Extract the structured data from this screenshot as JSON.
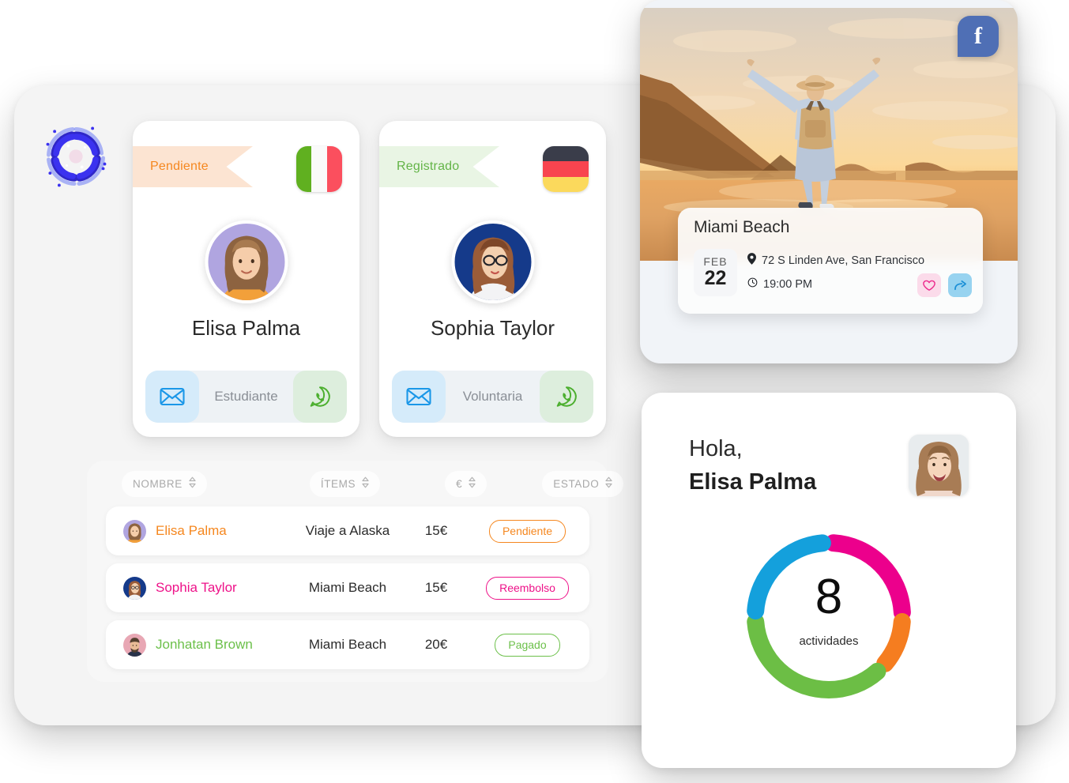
{
  "app": {
    "logo_name": "galaxy-spiral-logo",
    "panel_bg": "#f4f4f4"
  },
  "profile_cards": [
    {
      "status": "Pendiente",
      "status_color": "#f5871f",
      "status_bg": "#fce4d2",
      "flag": "it",
      "flag_label": "Italia",
      "name": "Elisa Palma",
      "role": "Estudiante",
      "mail_icon": "envelope-icon",
      "whatsapp_icon": "whatsapp-icon",
      "avatar_bg": "#b0a5e0"
    },
    {
      "status": "Registrado",
      "status_color": "#63b447",
      "status_bg": "#e9f5e4",
      "flag": "de",
      "flag_label": "Alemania",
      "name": "Sophia Taylor",
      "role": "Voluntaria",
      "mail_icon": "envelope-icon",
      "whatsapp_icon": "whatsapp-icon",
      "avatar_bg": "#153a8a"
    }
  ],
  "table": {
    "columns": [
      {
        "label": "NOMBRE",
        "sort": "sort-icon"
      },
      {
        "label": "ÍTEMS",
        "sort": "sort-icon"
      },
      {
        "label": "€",
        "sort": "sort-icon"
      },
      {
        "label": "ESTADO",
        "sort": "sort-icon"
      }
    ],
    "rows": [
      {
        "name": "Elisa Palma",
        "name_color": "#f5871f",
        "avatar_bg": "#b0a5e0",
        "item": "Viaje a Alaska",
        "amount": "15€",
        "status": "Pendiente",
        "status_color": "#f5871f"
      },
      {
        "name": "Sophia Taylor",
        "name_color": "#ee1289",
        "avatar_bg": "#153a8a",
        "item": "Miami Beach",
        "amount": "15€",
        "status": "Reembolso",
        "status_color": "#ee1289"
      },
      {
        "name": "Jonhatan Brown",
        "name_color": "#6cc04a",
        "avatar_bg": "#e8a7b4",
        "item": "Miami Beach",
        "amount": "20€",
        "status": "Pagado",
        "status_color": "#6cc04a"
      }
    ]
  },
  "event_card": {
    "photo_alt": "beach-sunset-traveler-photo",
    "facebook_glyph": "f",
    "facebook_bg": "#4f6fb5",
    "title": "Miami Beach",
    "month": "FEB",
    "day": "22",
    "location_icon": "map-pin-icon",
    "location": "72 S Linden Ave, San Francisco",
    "time_icon": "clock-icon",
    "time": "19:00 PM",
    "like_icon": "heart-icon",
    "share_icon": "share-arrow-icon"
  },
  "hola_card": {
    "greeting": "Hola,",
    "name": "Elisa Palma",
    "avatar_alt": "user-photo-smiling-woman"
  },
  "chart_data": {
    "type": "pie",
    "title": "",
    "center_value": "8",
    "center_label": "actividades",
    "categories": [
      "Rosa",
      "Naranja",
      "Verde",
      "Azul"
    ],
    "values": [
      2,
      1,
      3,
      2
    ],
    "colors": [
      "#ec008c",
      "#f57d20",
      "#6cbe45",
      "#14a0dc"
    ],
    "total": 8,
    "legend": "none",
    "donut": true
  }
}
